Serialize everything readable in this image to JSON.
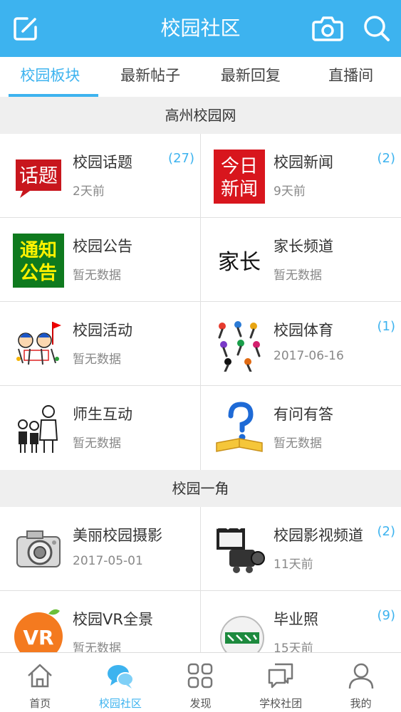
{
  "header": {
    "title": "校园社区",
    "left_icon": "edit-icon",
    "right_icons": [
      "camera-icon",
      "search-icon"
    ]
  },
  "tabs": [
    {
      "label": "校园板块",
      "active": true
    },
    {
      "label": "最新帖子",
      "active": false
    },
    {
      "label": "最新回复",
      "active": false
    },
    {
      "label": "直播间",
      "active": false
    }
  ],
  "sections": [
    {
      "title": "高州校园网",
      "items": [
        {
          "name": "校园话题",
          "sub": "2天前",
          "badge": "(27)",
          "icon": "topic-icon",
          "icon_text": [
            "话题"
          ]
        },
        {
          "name": "校园新闻",
          "sub": "9天前",
          "badge": "(2)",
          "icon": "news-icon",
          "icon_text": [
            "今日",
            "新闻"
          ]
        },
        {
          "name": "校园公告",
          "sub": "暂无数据",
          "badge": "",
          "icon": "notice-icon",
          "icon_text": [
            "通知",
            "公告"
          ]
        },
        {
          "name": "家长频道",
          "sub": "暂无数据",
          "badge": "",
          "icon": "parents-icon",
          "icon_text": [
            "家长"
          ]
        },
        {
          "name": "校园活动",
          "sub": "暂无数据",
          "badge": "",
          "icon": "activity-icon",
          "icon_text": []
        },
        {
          "name": "校园体育",
          "sub": "2017-06-16",
          "badge": "(1)",
          "icon": "sports-icon",
          "icon_text": []
        },
        {
          "name": "师生互动",
          "sub": "暂无数据",
          "badge": "",
          "icon": "teacher-student-icon",
          "icon_text": []
        },
        {
          "name": "有问有答",
          "sub": "暂无数据",
          "badge": "",
          "icon": "qa-book-icon",
          "icon_text": []
        }
      ]
    },
    {
      "title": "校园一角",
      "items": [
        {
          "name": "美丽校园摄影",
          "sub": "2017-05-01",
          "badge": "",
          "icon": "camera-photo-icon",
          "icon_text": []
        },
        {
          "name": "校园影视频道",
          "sub": "11天前",
          "badge": "(2)",
          "icon": "video-camera-icon",
          "icon_text": []
        },
        {
          "name": "校园VR全景",
          "sub": "暂无数据",
          "badge": "",
          "icon": "vr-icon",
          "icon_text": [
            "VR"
          ]
        },
        {
          "name": "毕业照",
          "sub": "15天前",
          "badge": "(9)",
          "icon": "graduation-icon",
          "icon_text": []
        }
      ]
    }
  ],
  "bottom_nav": [
    {
      "label": "首页",
      "icon": "home-icon",
      "active": false
    },
    {
      "label": "校园社区",
      "icon": "chat-bubbles-icon",
      "active": true
    },
    {
      "label": "发现",
      "icon": "grid-icon",
      "active": false
    },
    {
      "label": "学校社团",
      "icon": "club-icon",
      "active": false
    },
    {
      "label": "我的",
      "icon": "user-icon",
      "active": false
    }
  ],
  "colors": {
    "accent": "#3db3ef",
    "background": "#efefef",
    "badge": "#3db3ef"
  }
}
